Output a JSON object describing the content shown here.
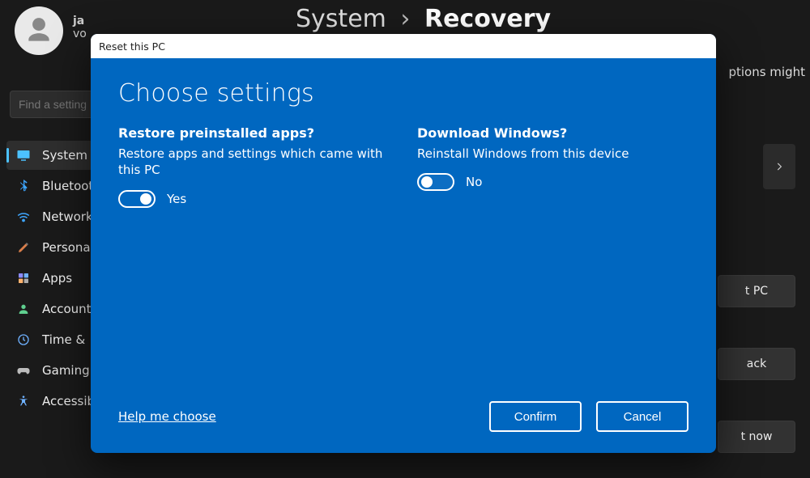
{
  "breadcrumb": {
    "parent": "System",
    "separator": "›",
    "current": "Recovery"
  },
  "user": {
    "line1": "ja",
    "line2": "vo"
  },
  "banner_tail": "ptions might",
  "search": {
    "placeholder": "Find a setting"
  },
  "nav": {
    "items": [
      {
        "label": "System"
      },
      {
        "label": "Bluetooth"
      },
      {
        "label": "Network"
      },
      {
        "label": "Personal"
      },
      {
        "label": "Apps"
      },
      {
        "label": "Account"
      },
      {
        "label": "Time &"
      },
      {
        "label": "Gaming"
      },
      {
        "label": "Accessibility"
      }
    ]
  },
  "side_buttons": {
    "reset": "t PC",
    "goback": "ack",
    "restart": "t now"
  },
  "modal": {
    "title": "Reset this PC",
    "heading": "Choose settings",
    "left": {
      "question": "Restore preinstalled apps?",
      "description": "Restore apps and settings which came with this PC",
      "value_label": "Yes"
    },
    "right": {
      "question": "Download Windows?",
      "description": "Reinstall Windows from this device",
      "value_label": "No"
    },
    "help": "Help me choose",
    "confirm": "Confirm",
    "cancel": "Cancel"
  }
}
